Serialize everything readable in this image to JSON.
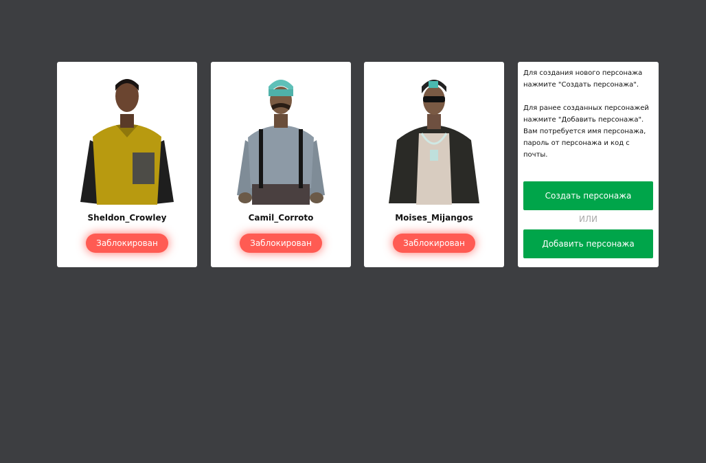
{
  "characters": [
    {
      "name": "Sheldon_Crowley",
      "status": "Заблокирован"
    },
    {
      "name": "Camil_Corroto",
      "status": "Заблокирован"
    },
    {
      "name": "Moises_Mijangos",
      "status": "Заблокирован"
    }
  ],
  "info": {
    "paragraph1": "Для создания нового персонажа нажмите \"Создать персонажа\".",
    "paragraph2": "Для ранее созданных персонажей нажмите \"Добавить персонажа\". Вам потребуется имя персонажа, пароль от персонажа и код с почты.",
    "create_label": "Создать персонажа",
    "or_label": "ИЛИ",
    "add_label": "Добавить персонажа"
  },
  "colors": {
    "background": "#3d3e41",
    "blocked_button": "#ff5b53",
    "action_button": "#00a54a"
  }
}
